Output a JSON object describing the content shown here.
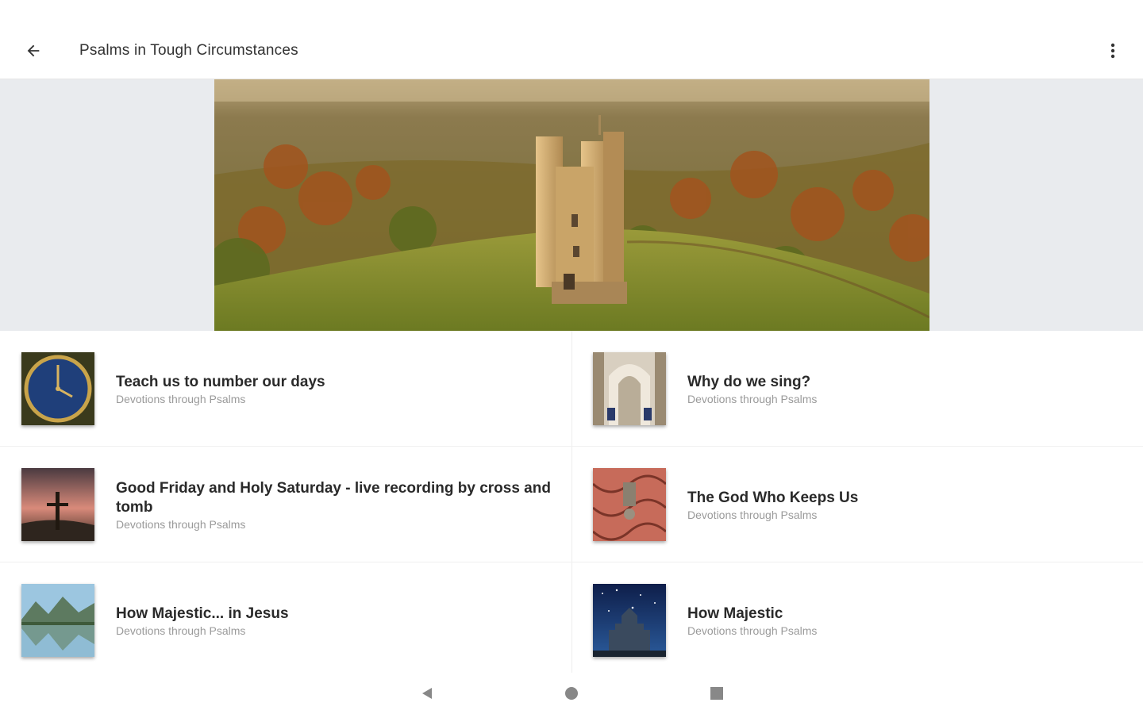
{
  "header": {
    "title": "Psalms in Tough Circumstances",
    "back_icon": "arrow-back-icon",
    "menu_icon": "more-vert-icon"
  },
  "hero": {
    "image": "castle-tower-landscape"
  },
  "items": [
    {
      "title": "Teach us to number our days",
      "subtitle": "Devotions through Psalms",
      "thumb": "clock-face"
    },
    {
      "title": "Why do we sing?",
      "subtitle": "Devotions through Psalms",
      "thumb": "cathedral-interior"
    },
    {
      "title": "Good Friday and Holy Saturday - live recording by cross and tomb",
      "subtitle": "Devotions through Psalms",
      "thumb": "cross-sunset"
    },
    {
      "title": "The God Who Keeps Us",
      "subtitle": "Devotions through Psalms",
      "thumb": "door-lock"
    },
    {
      "title": "How Majestic... in Jesus",
      "subtitle": "Devotions through Psalms",
      "thumb": "mountain-lake"
    },
    {
      "title": "How Majestic",
      "subtitle": "Devotions through Psalms",
      "thumb": "castle-night-sky"
    }
  ],
  "nav": {
    "back_icon": "nav-back-triangle-icon",
    "home_icon": "nav-home-circle-icon",
    "recents_icon": "nav-recents-square-icon"
  },
  "colors": {
    "background": "#ffffff",
    "hero_band": "#e9ebee",
    "title_text": "#2a2a2a",
    "subtitle_text": "#9a9a9a"
  }
}
